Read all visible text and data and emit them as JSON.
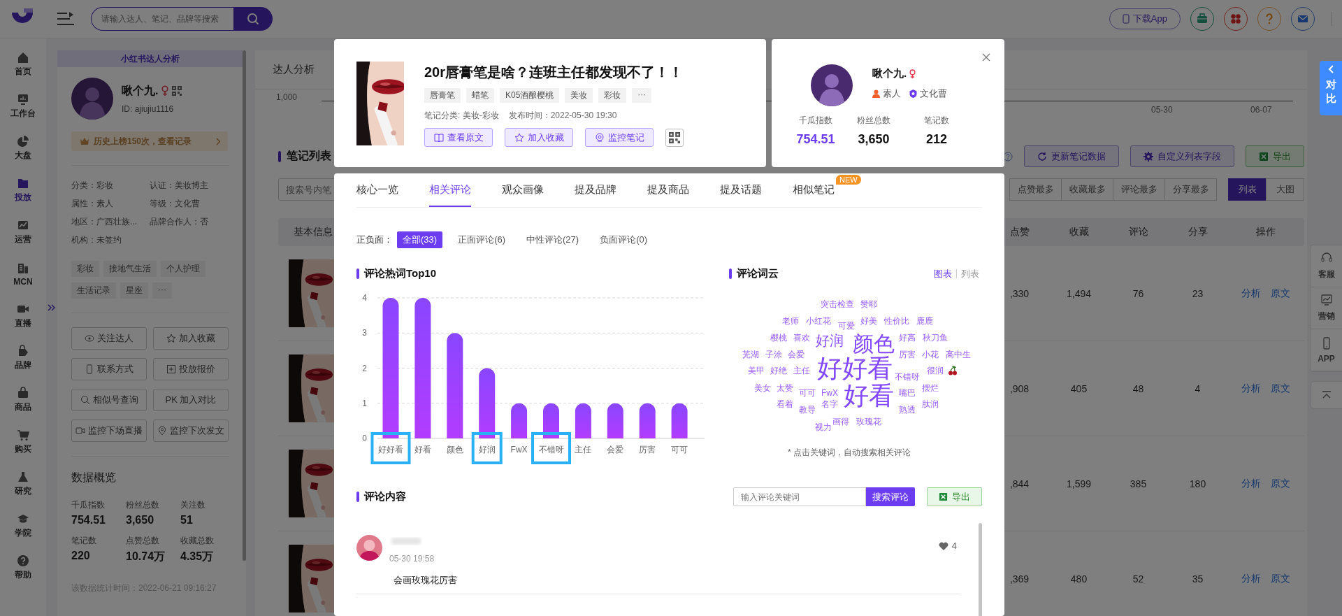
{
  "top_bar": {
    "search": {
      "placeholder": "请输入达人、笔记、品牌等搜索"
    },
    "download_button": "下载App"
  },
  "nav": [
    {
      "label": "首页",
      "selected": false
    },
    {
      "label": "工作台",
      "selected": false
    },
    {
      "label": "大盘",
      "selected": false
    },
    {
      "label": "投放",
      "selected": true
    },
    {
      "label": "运营",
      "selected": false
    },
    {
      "label": "MCN",
      "selected": false
    },
    {
      "label": "直播",
      "selected": false
    },
    {
      "label": "品牌",
      "selected": false
    },
    {
      "label": "商品",
      "selected": false
    },
    {
      "label": "购买",
      "selected": false
    },
    {
      "label": "研究",
      "selected": false
    },
    {
      "label": "学院",
      "selected": false
    },
    {
      "label": "帮助",
      "selected": false
    }
  ],
  "creator_panel": {
    "header": "小红书达人分析",
    "name": "啾个九.",
    "id": "ID:  ajiujiu1116",
    "rank_banner": "历史上榜150次，查看记录",
    "info": [
      "分类：彩妆",
      "认证：美妆博主",
      "属性：素人",
      "等级：文化曹",
      "地区：广西壮族...",
      "品牌合作人：否",
      "机构：未签约"
    ],
    "tags": [
      "彩妆",
      "接地气生活",
      "个人护理",
      "生活记录",
      "星座",
      "···"
    ],
    "actions": [
      "关注达人",
      "加入收藏",
      "联系方式",
      "投放报价",
      "相似号查询",
      "PK 加入对比",
      "监控下场直播",
      "监控下次发文"
    ],
    "overview_title": "数据概览",
    "stats": [
      {
        "label": "千瓜指数",
        "value": "754.51"
      },
      {
        "label": "粉丝总数",
        "value": "3,650"
      },
      {
        "label": "关注数",
        "value": "51"
      },
      {
        "label": "笔记数",
        "value": "220"
      },
      {
        "label": "点赞总数",
        "value": "10.74万"
      },
      {
        "label": "收藏总数",
        "value": "4.35万"
      }
    ],
    "updated": "该数据统计时间：2022-06-21 09:16:27"
  },
  "main": {
    "tab": "达人分析",
    "trend": {
      "y_label": "1,000",
      "x_labels": [
        "05-30",
        "06-07"
      ]
    },
    "notes_title": "笔记列表",
    "toolbar": [
      "更新笔记数据",
      "自定义列表字段"
    ],
    "export": "导出",
    "search": {
      "placeholder": "搜索号内笔"
    },
    "sorts": [
      {
        "label": "点赞最多",
        "selected": false
      },
      {
        "label": "收藏最多",
        "selected": false
      },
      {
        "label": "评论最多",
        "selected": false
      },
      {
        "label": "分享最多",
        "selected": false
      }
    ],
    "views": [
      {
        "label": "列表",
        "selected": true
      },
      {
        "label": "大图",
        "selected": false
      }
    ],
    "columns": [
      "基本信息",
      "点赞",
      "收藏",
      "评论",
      "分享",
      "操作"
    ],
    "rows": [
      {
        "likes": ",330",
        "collects": "1,494",
        "comments": "76",
        "shares": "23",
        "actions": [
          "分析",
          "原文"
        ]
      },
      {
        "likes": ",908",
        "collects": "405",
        "comments": "48",
        "shares": "4",
        "actions": [
          "分析",
          "原文"
        ]
      },
      {
        "likes": ",844",
        "collects": "1,599",
        "comments": "385",
        "shares": "180",
        "actions": [
          "分析",
          "原文"
        ]
      },
      {
        "likes": ",369",
        "collects": "480",
        "comments": "52",
        "shares": "35",
        "actions": [
          "分析",
          "原文"
        ]
      }
    ]
  },
  "side_tools": {
    "compare": "对比",
    "items": [
      "客服",
      "营销",
      "APP"
    ]
  },
  "modal": {
    "note": {
      "title": "20r唇膏笔是啥？连班主任都发现不了！！",
      "tags": [
        "唇膏笔",
        "蜡笔",
        "K05酒酿樱桃",
        "美妆",
        "彩妆",
        "···"
      ],
      "category": "笔记分类: 美妆-彩妆",
      "published": "发布时间：2022-05-30 19:30",
      "buttons": [
        "查看原文",
        "加入收藏",
        "监控笔记"
      ]
    },
    "author": {
      "name": "啾个九.",
      "type": "素人",
      "level": "文化曹",
      "stats": [
        {
          "label": "千瓜指数",
          "value": "754.51",
          "kind": "accent"
        },
        {
          "label": "粉丝总数",
          "value": "3,650",
          "kind": "plain"
        },
        {
          "label": "笔记数",
          "value": "212",
          "kind": "plain"
        }
      ]
    },
    "tabs": [
      {
        "label": "核心一览",
        "selected": false
      },
      {
        "label": "相关评论",
        "selected": true
      },
      {
        "label": "观众画像",
        "selected": false
      },
      {
        "label": "提及品牌",
        "selected": false
      },
      {
        "label": "提及商品",
        "selected": false
      },
      {
        "label": "提及话题",
        "selected": false
      },
      {
        "label": "相似笔记",
        "selected": false,
        "badge": "NEW"
      }
    ],
    "sentiment": {
      "label": "正负面：",
      "options": [
        {
          "label": "全部(33)",
          "selected": true
        },
        {
          "label": "正面评论(6)",
          "selected": false
        },
        {
          "label": "中性评论(27)",
          "selected": false
        },
        {
          "label": "负面评论(0)",
          "selected": false
        }
      ]
    },
    "hot_words": {
      "chart_data": {
        "type": "bar",
        "title": "评论热词Top10",
        "categories": [
          "好好看",
          "好看",
          "颜色",
          "好润",
          "FwX",
          "不错呀",
          "主任",
          "会爱",
          "厉害",
          "可可"
        ],
        "values": [
          4,
          4,
          3,
          2,
          1,
          1,
          1,
          1,
          1,
          1
        ],
        "ylim": [
          0,
          4
        ],
        "yticks": [
          0,
          1,
          2,
          3,
          4
        ],
        "grid": true
      },
      "highlighted_labels": [
        true,
        false,
        false,
        true,
        false,
        true,
        false,
        false,
        false,
        false
      ]
    },
    "word_cloud": {
      "title": "评论词云",
      "views": [
        {
          "label": "图表",
          "selected": true
        },
        {
          "label": "列表",
          "selected": false
        }
      ],
      "words": [
        {
          "text": "突击检查",
          "kind": "small"
        },
        {
          "text": "赞耶",
          "kind": "small"
        },
        {
          "text": "老师",
          "kind": "small"
        },
        {
          "text": "小红花",
          "kind": "small"
        },
        {
          "text": "可爱",
          "kind": "small"
        },
        {
          "text": "好美",
          "kind": "small"
        },
        {
          "text": "性价比",
          "kind": "small"
        },
        {
          "text": "鹿鹿",
          "kind": "small"
        },
        {
          "text": "樱桃",
          "kind": "small"
        },
        {
          "text": "喜欢",
          "kind": "small"
        },
        {
          "text": "好润",
          "kind": "medium"
        },
        {
          "text": "颜色",
          "kind": "large"
        },
        {
          "text": "好高",
          "kind": "small"
        },
        {
          "text": "秋刀鱼",
          "kind": "small"
        },
        {
          "text": "芜湖",
          "kind": "small"
        },
        {
          "text": "子涂",
          "kind": "small"
        },
        {
          "text": "会爱",
          "kind": "small"
        },
        {
          "text": "厉害",
          "kind": "small"
        },
        {
          "text": "小花",
          "kind": "small"
        },
        {
          "text": "高中生",
          "kind": "small"
        },
        {
          "text": "美甲",
          "kind": "small"
        },
        {
          "text": "好绝",
          "kind": "small"
        },
        {
          "text": "主任",
          "kind": "small"
        },
        {
          "text": "好好看",
          "kind": "xlarge"
        },
        {
          "text": "不错呀",
          "kind": "small"
        },
        {
          "text": "很润",
          "kind": "small"
        },
        {
          "text": "美女",
          "kind": "small"
        },
        {
          "text": "太赞",
          "kind": "small"
        },
        {
          "text": "可可",
          "kind": "small"
        },
        {
          "text": "FwX",
          "kind": "small"
        },
        {
          "text": "好看",
          "kind": "xlarge"
        },
        {
          "text": "嘴巴",
          "kind": "small"
        },
        {
          "text": "摆烂",
          "kind": "small"
        },
        {
          "text": "看着",
          "kind": "small"
        },
        {
          "text": "教导",
          "kind": "small"
        },
        {
          "text": "名字",
          "kind": "small"
        },
        {
          "text": "熟透",
          "kind": "small"
        },
        {
          "text": "肽润",
          "kind": "small"
        },
        {
          "text": "画得",
          "kind": "small"
        },
        {
          "text": "玫瑰花",
          "kind": "small"
        },
        {
          "text": "视力",
          "kind": "small"
        }
      ],
      "hint": "* 点击关键词，自动搜索相关评论"
    },
    "comments": {
      "title": "评论内容",
      "search": {
        "placeholder": "输入评论关键词"
      },
      "search_button": "搜索评论",
      "export": "导出",
      "items": [
        {
          "time": "05-30 19:58",
          "likes": "4",
          "text": "会画玫瑰花厉害"
        }
      ]
    }
  }
}
